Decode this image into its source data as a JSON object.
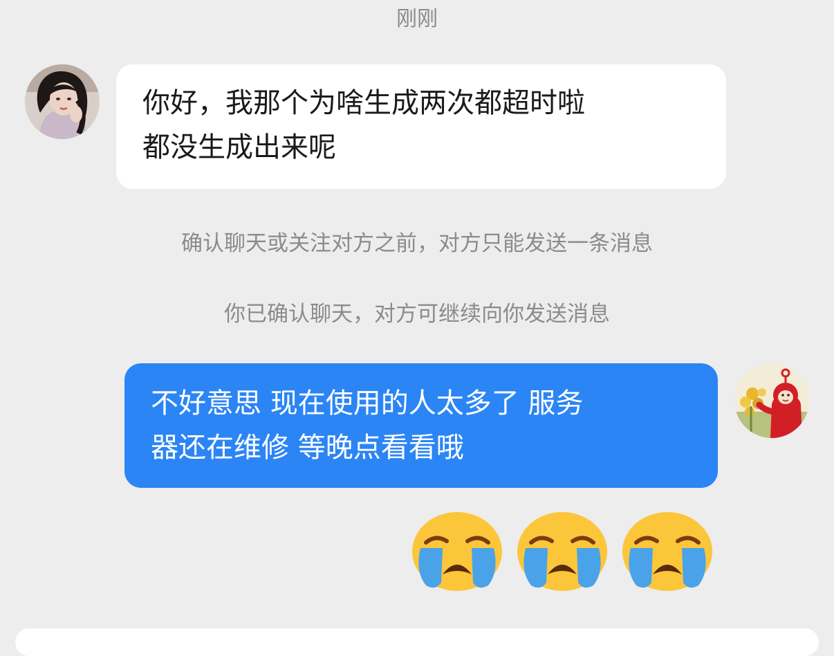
{
  "chat": {
    "timestamp": "刚刚",
    "messages": [
      {
        "sender": "other",
        "avatar": "woman-portrait",
        "lines": [
          "你好，我那个为啥生成两次都超时啦",
          "都没生成出来呢"
        ]
      },
      {
        "type": "system",
        "text": "确认聊天或关注对方之前，对方只能发送一条消息"
      },
      {
        "type": "system",
        "text": "你已确认聊天，对方可继续向你发送消息"
      },
      {
        "sender": "me",
        "avatar": "red-teletubby",
        "lines": [
          "不好意思 现在使用的人太多了 服务",
          "器还在维修 等晚点看看哦"
        ]
      },
      {
        "sender": "me",
        "emojis": [
          "loudly-crying-face",
          "loudly-crying-face",
          "loudly-crying-face"
        ]
      }
    ]
  },
  "colors": {
    "background": "#ededed",
    "incoming_bubble": "#ffffff",
    "outgoing_bubble": "#2b85f5",
    "system_text": "#8b8b8b"
  }
}
